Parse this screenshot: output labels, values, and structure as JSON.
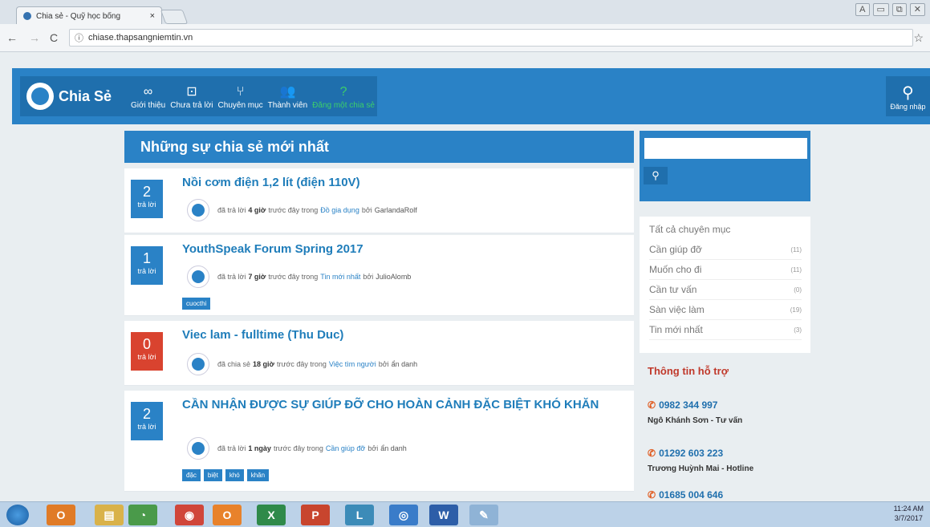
{
  "browser": {
    "tab_title": "Chia sẻ - Quỹ học bổng",
    "url": "chiase.thapsangniemtin.vn"
  },
  "site": {
    "brand": "Chia Sẻ",
    "nav": [
      {
        "label": "Giới thiệu",
        "icon": "∞"
      },
      {
        "label": "Chưa trả lời",
        "icon": "⊡"
      },
      {
        "label": "Chuyên mục",
        "icon": "⑂"
      },
      {
        "label": "Thành viên",
        "icon": "👥"
      },
      {
        "label": "Đăng một chia sẻ",
        "icon": "?"
      }
    ],
    "login_label": "Đăng nhập"
  },
  "main": {
    "heading": "Những sự chia sẻ mới nhất",
    "questions": [
      {
        "count": "2",
        "count_label": "trả lời",
        "title": "Nồi cơm điện 1,2 lít (điện 110V)",
        "action": "đã trả lời",
        "time": "4 giờ",
        "ago": "trước đây trong",
        "category": "Đồ gia dụng",
        "by": "bởi",
        "user": "GarlandaRolf",
        "tags": []
      },
      {
        "count": "1",
        "count_label": "trả lời",
        "title": "YouthSpeak Forum Spring 2017",
        "action": "đã trả lời",
        "time": "7 giờ",
        "ago": "trước đây trong",
        "category": "Tin mới nhất",
        "by": "bởi",
        "user": "JulioAlomb",
        "tags": [
          "cuocthi"
        ]
      },
      {
        "count": "0",
        "count_label": "trả lời",
        "title": "Viec lam - fulltime (Thu Duc)",
        "action": "đã chia sẻ",
        "time": "18 giờ",
        "ago": "trước đây trong",
        "category": "Việc tìm người",
        "by": "bởi",
        "user": "ẩn danh",
        "tags": []
      },
      {
        "count": "2",
        "count_label": "trả lời",
        "title": "CẦN NHẬN ĐƯỢC SỰ GIÚP ĐỠ CHO HOÀN CẢNH ĐẶC BIỆT KHÓ KHĂN",
        "action": "đã trả lời",
        "time": "1 ngày",
        "ago": "trước đây trong",
        "category": "Cần giúp đỡ",
        "by": "bởi",
        "user": "ẩn danh",
        "tags": [
          "đặc",
          "biệt",
          "khó",
          "khăn"
        ]
      }
    ]
  },
  "sidebar": {
    "search_placeholder": "",
    "search_icon": "magnifier-icon",
    "categories": [
      {
        "label": "Tất cả chuyên mục",
        "count": ""
      },
      {
        "label": "Cần giúp đỡ",
        "count": "(11)"
      },
      {
        "label": "Muốn cho đi",
        "count": "(11)"
      },
      {
        "label": "Cần tư vấn",
        "count": "(0)"
      },
      {
        "label": "Sàn việc làm",
        "count": "(19)"
      },
      {
        "label": "Tin mới nhất",
        "count": "(3)"
      }
    ],
    "support_heading": "Thông tin hỗ trợ",
    "contacts": [
      {
        "phone": "0982 344 997",
        "name": "Ngô Khánh Sơn - Tư vấn"
      },
      {
        "phone": "01292 603 223",
        "name": "Trương Huỳnh Mai - Hotline"
      },
      {
        "phone": "01685 004 646",
        "name": ""
      }
    ]
  },
  "taskbar": {
    "time": "11:24 AM",
    "date": "3/7/2017"
  }
}
